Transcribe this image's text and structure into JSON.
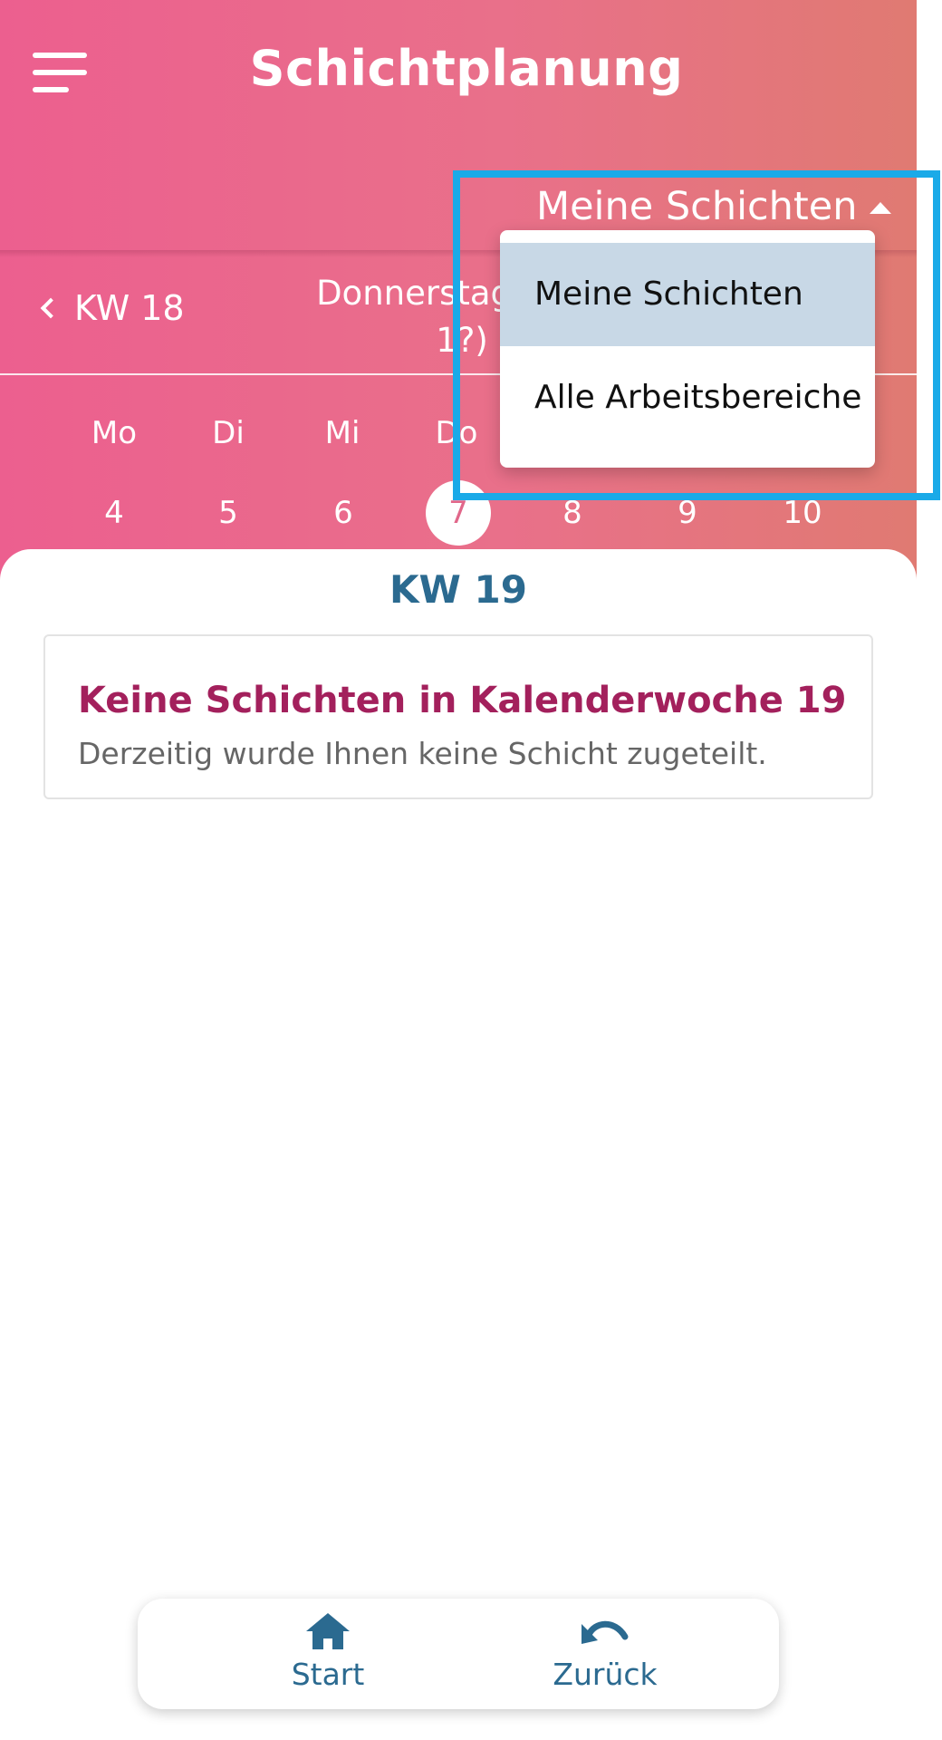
{
  "header": {
    "title": "Schichtplanung",
    "filter_label": "Meine Schichten"
  },
  "week_nav": {
    "prev_label": "KW 18",
    "current_date_line1": "Donnerstag, 07.0",
    "current_date_line2": "1?)"
  },
  "calendar": {
    "weekdays": [
      "Mo",
      "Di",
      "Mi",
      "Do"
    ],
    "days": [
      "4",
      "5",
      "6",
      "7",
      "8",
      "9",
      "10"
    ],
    "selected_day": "7"
  },
  "content": {
    "week_title": "KW 19",
    "empty_title": "Keine Schichten in Kalenderwoche 19",
    "empty_text": "Derzeitig wurde Ihnen keine Schicht zugeteilt."
  },
  "dropdown": {
    "items": [
      "Meine Schichten",
      "Alle Arbeitsbereiche"
    ],
    "selected": "Meine Schichten"
  },
  "bottom_nav": {
    "start_label": "Start",
    "start_icon": "home-icon",
    "back_label": "Zurück",
    "back_icon": "undo-icon"
  },
  "colors": {
    "header_gradient_start": "#ec5f8f",
    "header_gradient_end": "#e07a72",
    "accent_blue": "#2b6a90",
    "empty_title": "#a3205c",
    "highlight": "#1aaae8",
    "dropdown_selected": "#c8d8e6"
  }
}
